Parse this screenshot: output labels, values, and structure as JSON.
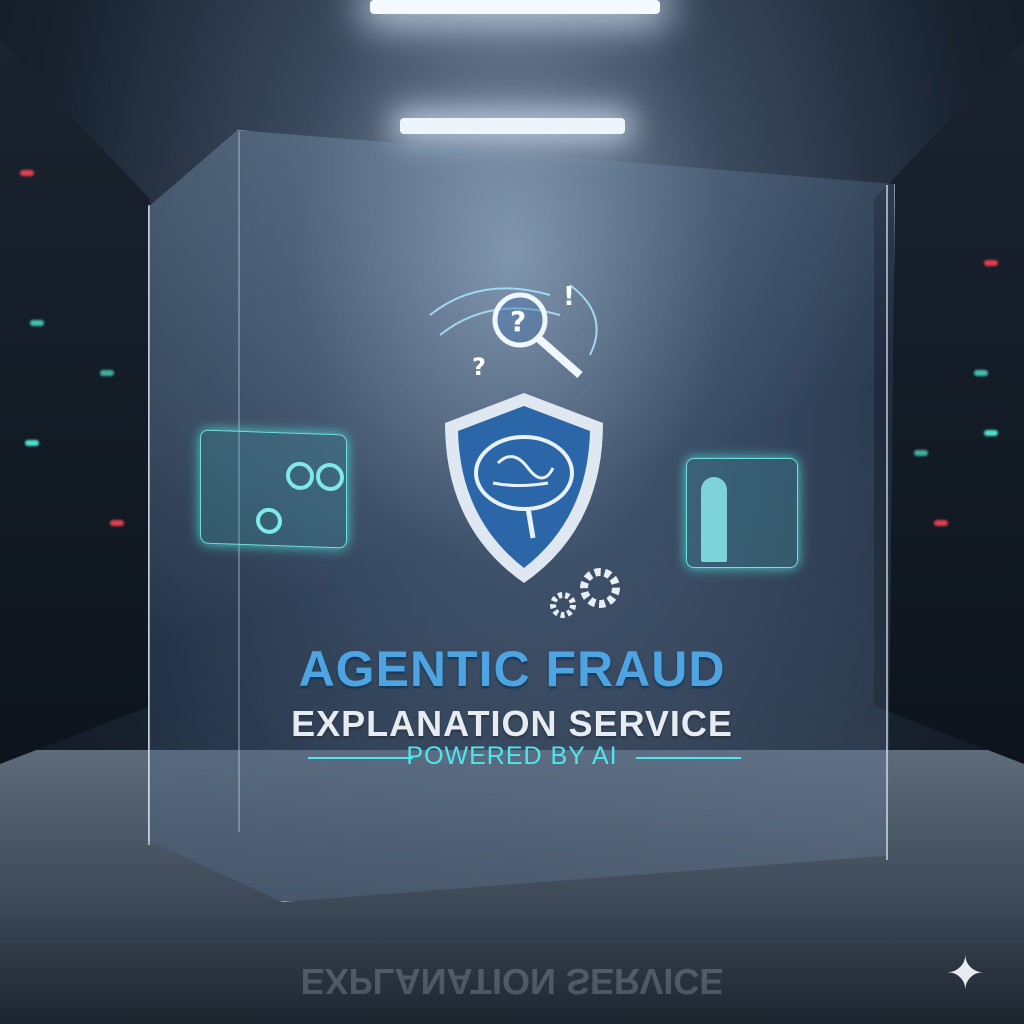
{
  "title": {
    "line1": "AGENTIC FRAUD",
    "line2": "EXPLANATION SERVICE",
    "tagline": "POWERED BY AI"
  },
  "icons": {
    "center": "brain-shield-icon",
    "top": "magnifier-question-icon",
    "gears": "gears-icon",
    "left_panel": "dashboard-panel",
    "right_panel": "person-analytics-panel",
    "corner": "sparkle-icon"
  },
  "colors": {
    "title_blue": "#4ea4e0",
    "tagline_cyan": "#4fe6ee",
    "hologram": "#6fe0e0"
  }
}
